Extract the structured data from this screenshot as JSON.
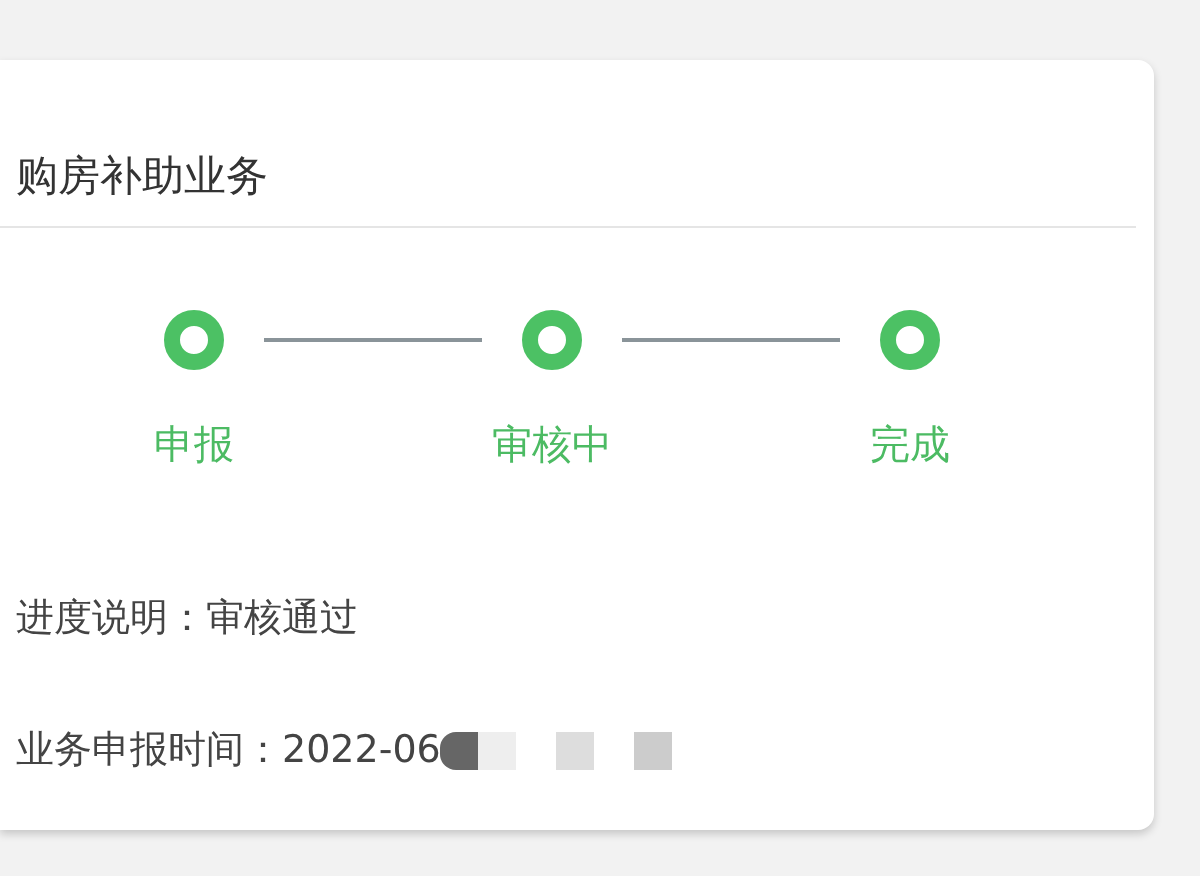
{
  "card": {
    "title": "购房补助业务",
    "steps": [
      {
        "label": "申报",
        "done": true
      },
      {
        "label": "审核中",
        "done": true
      },
      {
        "label": "完成",
        "done": true
      }
    ],
    "progress": {
      "label": "进度说明：",
      "value": "审核通过"
    },
    "submitted": {
      "label": "业务申报时间：",
      "value": "2022-06"
    }
  }
}
